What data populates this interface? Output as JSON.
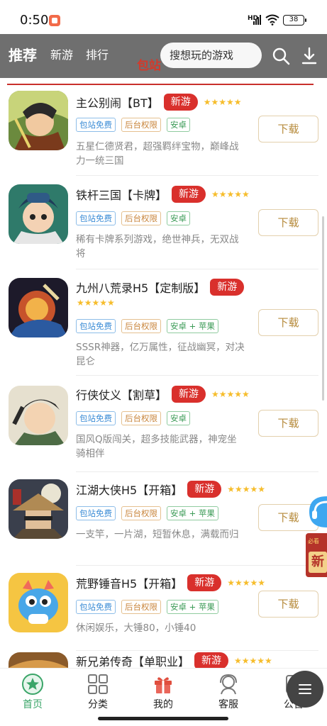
{
  "status": {
    "time": "0:50",
    "network": "HD",
    "battery": "38"
  },
  "nav": {
    "tabs": [
      "推荐",
      "新游",
      "排行"
    ],
    "search_placeholder": "搜想玩的游戏",
    "peek_text": "包站"
  },
  "games": [
    {
      "title": "主公别闹【BT】",
      "badge": "新游",
      "stars": "★★★★★",
      "tags": [
        "包站免费",
        "后台权限",
        "安卓"
      ],
      "desc": "五星仁德贤君，超强羁绊宝物，巅峰战力一统三国",
      "download": "下载"
    },
    {
      "title": "铁杆三国【卡牌】",
      "badge": "新游",
      "stars": "★★★★★",
      "tags": [
        "包站免费",
        "后台权限",
        "安卓"
      ],
      "desc": "稀有卡牌系列游戏，绝世神兵，无双战将",
      "download": "下载"
    },
    {
      "title": "九州八荒录H5【定制版】",
      "badge": "新游",
      "stars": "★★★★★",
      "tags": [
        "包站免费",
        "后台权限",
        "安卓 + 苹果"
      ],
      "desc": "SSSR神器，亿万属性，征战幽冥，对决昆仑",
      "download": "下载"
    },
    {
      "title": "行侠仗义【割草】",
      "badge": "新游",
      "stars": "★★★★★",
      "tags": [
        "包站免费",
        "后台权限",
        "安卓"
      ],
      "desc": "国风Q版闯关，超多技能武器，神宠坐骑相伴",
      "download": "下载"
    },
    {
      "title": "江湖大侠H5【开箱】",
      "badge": "新游",
      "stars": "★★★★★",
      "tags": [
        "包站免费",
        "后台权限",
        "安卓 + 苹果"
      ],
      "desc": "一支竿，一片湖，短暂休息，满载而归",
      "download": "下载"
    },
    {
      "title": "荒野锤音H5【开箱】",
      "badge": "新游",
      "stars": "★★★★★",
      "tags": [
        "包站免费",
        "后台权限",
        "安卓 + 苹果"
      ],
      "desc": "休闲娱乐，大锤80，小锤40",
      "download": "下载"
    },
    {
      "title": "新兄弟传奇【单职业】",
      "badge": "新游",
      "stars": "★★★★★",
      "tags": [],
      "desc": "",
      "download": ""
    }
  ],
  "float": {
    "gift_label": "必看",
    "gift_char": "新"
  },
  "bottom_nav": [
    "首页",
    "分类",
    "我的",
    "客服",
    "公告"
  ]
}
